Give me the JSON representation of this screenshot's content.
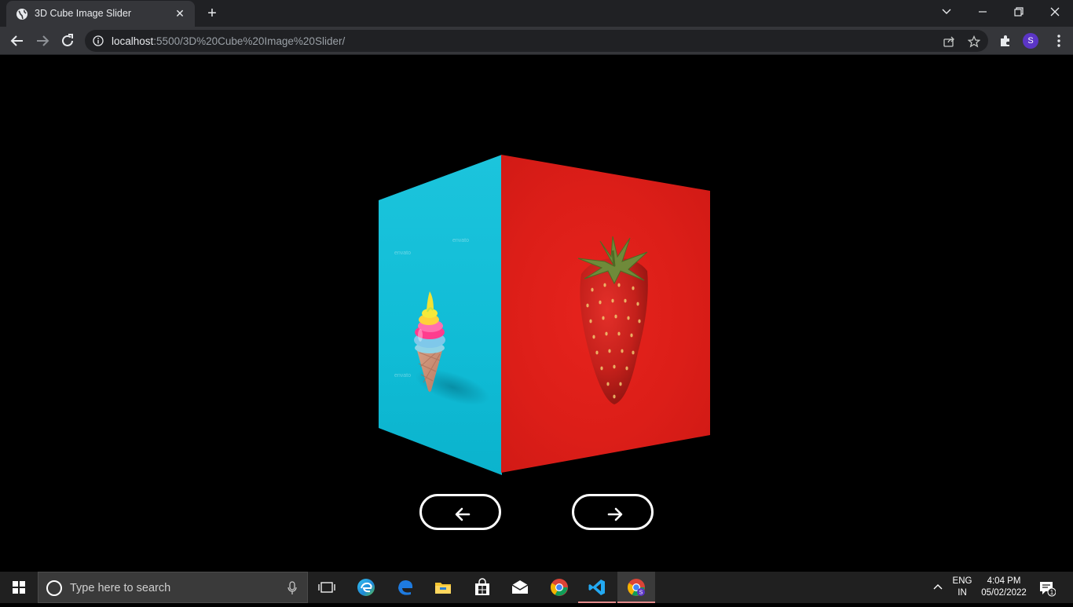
{
  "browser": {
    "tab": {
      "title": "3D Cube Image Slider",
      "close_label": "✕",
      "favicon": "globe-icon"
    },
    "new_tab_label": "+",
    "toolbar": {
      "url_host": "localhost",
      "url_rest": ":5500/3D%20Cube%20Image%20Slider/",
      "profile_initial": "S"
    }
  },
  "page": {
    "cube": {
      "left_face_image": "rainbow soft-serve ice cream cone on cyan background",
      "right_face_image": "strawberry on red background",
      "colors": {
        "left_face": "#10bcd6",
        "right_face": "#dc1e18"
      },
      "watermarks": [
        "envato",
        "envato",
        "envato"
      ]
    },
    "prev_button_icon": "arrow-left-icon",
    "next_button_icon": "arrow-right-icon"
  },
  "taskbar": {
    "search_placeholder": "Type here to search",
    "language": {
      "line1": "ENG",
      "line2": "IN"
    },
    "clock": {
      "time": "4:04 PM",
      "date": "05/02/2022"
    },
    "notification_count": "1",
    "apps": [
      "task-view-icon",
      "edge-new-icon",
      "edge-legacy-icon",
      "file-explorer-icon",
      "store-icon",
      "mail-icon",
      "chrome-icon",
      "vscode-icon",
      "chrome-profile-icon"
    ]
  }
}
